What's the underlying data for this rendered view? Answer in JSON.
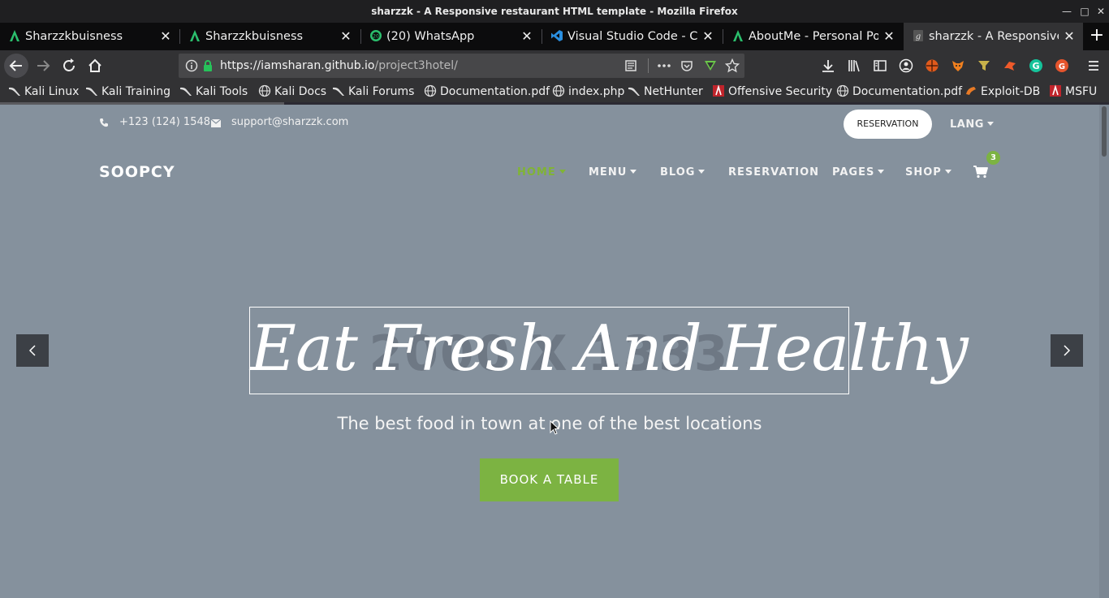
{
  "window": {
    "title": "sharzzk - A Responsive restaurant HTML template - Mozilla Firefox"
  },
  "tabs": [
    {
      "label": "Sharzzkbuisness",
      "icon": "green-a-icon"
    },
    {
      "label": "Sharzzkbuisness",
      "icon": "green-a-icon"
    },
    {
      "label": "(20) WhatsApp",
      "icon": "whatsapp-icon"
    },
    {
      "label": "Visual Studio Code - Cod",
      "icon": "vscode-icon"
    },
    {
      "label": "AboutMe - Personal Port",
      "icon": "green-a-icon"
    },
    {
      "label": "sharzzk - A Responsive r",
      "icon": "page-icon"
    }
  ],
  "urlbar": {
    "host": "https://iamsharan.github.io",
    "path": "/project3hotel/"
  },
  "bookmarks": [
    {
      "label": "Kali Linux",
      "icon": "kali-icon"
    },
    {
      "label": "Kali Training",
      "icon": "kali-icon"
    },
    {
      "label": "Kali Tools",
      "icon": "kali-icon"
    },
    {
      "label": "Kali Docs",
      "icon": "globe-icon"
    },
    {
      "label": "Kali Forums",
      "icon": "kali-icon"
    },
    {
      "label": "Documentation.pdf",
      "icon": "globe-icon"
    },
    {
      "label": "index.php",
      "icon": "globe-icon"
    },
    {
      "label": "NetHunter",
      "icon": "kali-icon"
    },
    {
      "label": "Offensive Security",
      "icon": "offsec-icon"
    },
    {
      "label": "Documentation.pdf",
      "icon": "globe-icon"
    },
    {
      "label": "Exploit-DB",
      "icon": "exploitdb-icon"
    },
    {
      "label": "MSFU",
      "icon": "offsec-icon"
    }
  ],
  "site": {
    "phone": "+123 (124) 1548",
    "email": "support@sharzzk.com",
    "reservation_btn": "RESERVATION",
    "lang": "LANG",
    "brand": "SOOPCY",
    "nav": {
      "home": "HOME",
      "menu": "MENU",
      "blog": "BLOG",
      "reservation": "RESERVATION",
      "pages": "PAGES",
      "shop": "SHOP"
    },
    "cart_count": "3",
    "hero": {
      "ghost": "2000 X 1333",
      "title": "Eat Fresh And Healthy",
      "subtitle": "The best food in town at one of the best locations",
      "cta": "BOOK A TABLE"
    }
  },
  "colors": {
    "accent": "#7cb342",
    "page_bg": "#85919d",
    "chrome_dark": "#0c0c0d"
  }
}
